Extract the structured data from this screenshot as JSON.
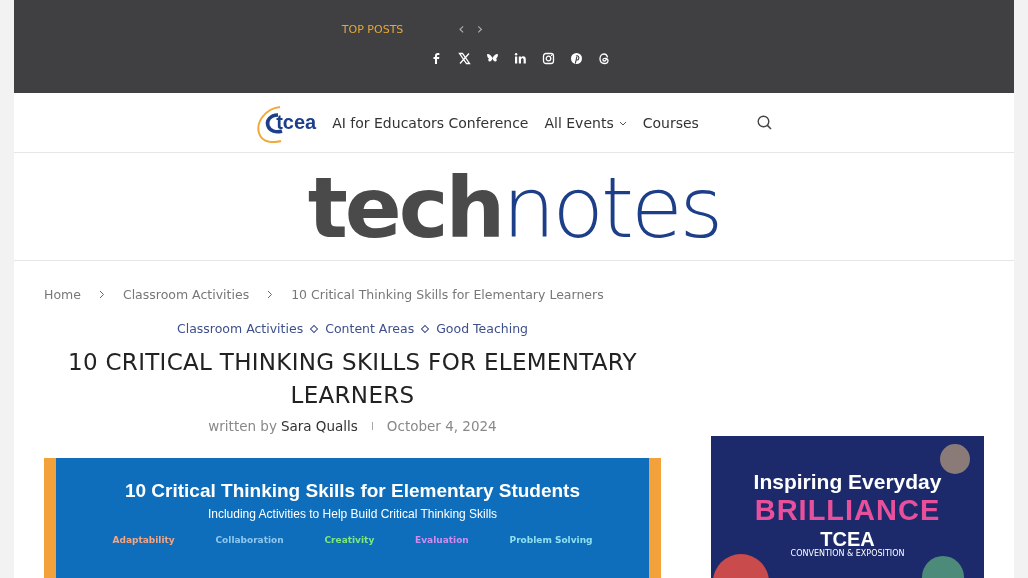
{
  "top_bar": {
    "label": "TOP POSTS",
    "nav": [
      "‹",
      "›"
    ]
  },
  "nav": {
    "logo": "tcea",
    "items": [
      {
        "label": "AI for Educators Conference",
        "dropdown": false
      },
      {
        "label": "All Events",
        "dropdown": true
      },
      {
        "label": "Courses",
        "dropdown": false
      }
    ]
  },
  "site_logo": "**tech**notes",
  "breadcrumb": [
    "Home",
    "Classroom Activities",
    "10 Critical Thinking Skills for Elementary Learners"
  ],
  "article": {
    "categories": [
      "Classroom Activities",
      "Content Areas",
      "Good Teaching"
    ],
    "title": "10 CRITICAL THINKING SKILLS FOR ELEMENTARY LEARNERS",
    "byline": "written by",
    "author": "Sara Qualls",
    "date": "October 4, 2024",
    "hero": {
      "title": "10 Critical Thinking Skills for Elementary Students",
      "subtitle": "Including Activities to Help Build Critical Thinking Skills",
      "skills": [
        {
          "label": "Adaptability",
          "color": "#f4a582"
        },
        {
          "label": "Collaboration",
          "color": "#8ec8f0"
        },
        {
          "label": "Creativity",
          "color": "#7ee87e"
        },
        {
          "label": "Evaluation",
          "color": "#d28cf0"
        },
        {
          "label": "Problem Solving",
          "color": "#8ee0f0"
        }
      ]
    }
  },
  "ad": {
    "line1": "Inspiring Everyday",
    "line2": "BRILLIANCE",
    "brand": "TCEA",
    "tagline": "CONVENTION & EXPOSITION"
  }
}
